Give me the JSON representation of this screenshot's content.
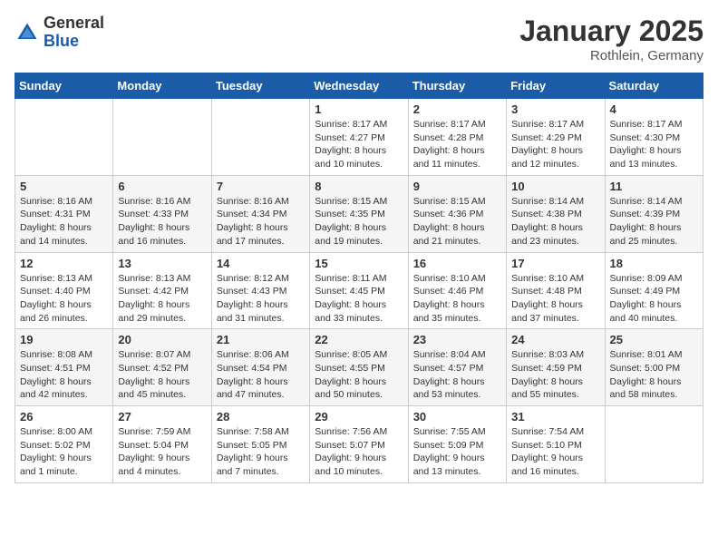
{
  "logo": {
    "general": "General",
    "blue": "Blue"
  },
  "header": {
    "month": "January 2025",
    "location": "Rothlein, Germany"
  },
  "weekdays": [
    "Sunday",
    "Monday",
    "Tuesday",
    "Wednesday",
    "Thursday",
    "Friday",
    "Saturday"
  ],
  "weeks": [
    [
      {
        "day": "",
        "info": ""
      },
      {
        "day": "",
        "info": ""
      },
      {
        "day": "",
        "info": ""
      },
      {
        "day": "1",
        "info": "Sunrise: 8:17 AM\nSunset: 4:27 PM\nDaylight: 8 hours\nand 10 minutes."
      },
      {
        "day": "2",
        "info": "Sunrise: 8:17 AM\nSunset: 4:28 PM\nDaylight: 8 hours\nand 11 minutes."
      },
      {
        "day": "3",
        "info": "Sunrise: 8:17 AM\nSunset: 4:29 PM\nDaylight: 8 hours\nand 12 minutes."
      },
      {
        "day": "4",
        "info": "Sunrise: 8:17 AM\nSunset: 4:30 PM\nDaylight: 8 hours\nand 13 minutes."
      }
    ],
    [
      {
        "day": "5",
        "info": "Sunrise: 8:16 AM\nSunset: 4:31 PM\nDaylight: 8 hours\nand 14 minutes."
      },
      {
        "day": "6",
        "info": "Sunrise: 8:16 AM\nSunset: 4:33 PM\nDaylight: 8 hours\nand 16 minutes."
      },
      {
        "day": "7",
        "info": "Sunrise: 8:16 AM\nSunset: 4:34 PM\nDaylight: 8 hours\nand 17 minutes."
      },
      {
        "day": "8",
        "info": "Sunrise: 8:15 AM\nSunset: 4:35 PM\nDaylight: 8 hours\nand 19 minutes."
      },
      {
        "day": "9",
        "info": "Sunrise: 8:15 AM\nSunset: 4:36 PM\nDaylight: 8 hours\nand 21 minutes."
      },
      {
        "day": "10",
        "info": "Sunrise: 8:14 AM\nSunset: 4:38 PM\nDaylight: 8 hours\nand 23 minutes."
      },
      {
        "day": "11",
        "info": "Sunrise: 8:14 AM\nSunset: 4:39 PM\nDaylight: 8 hours\nand 25 minutes."
      }
    ],
    [
      {
        "day": "12",
        "info": "Sunrise: 8:13 AM\nSunset: 4:40 PM\nDaylight: 8 hours\nand 26 minutes."
      },
      {
        "day": "13",
        "info": "Sunrise: 8:13 AM\nSunset: 4:42 PM\nDaylight: 8 hours\nand 29 minutes."
      },
      {
        "day": "14",
        "info": "Sunrise: 8:12 AM\nSunset: 4:43 PM\nDaylight: 8 hours\nand 31 minutes."
      },
      {
        "day": "15",
        "info": "Sunrise: 8:11 AM\nSunset: 4:45 PM\nDaylight: 8 hours\nand 33 minutes."
      },
      {
        "day": "16",
        "info": "Sunrise: 8:10 AM\nSunset: 4:46 PM\nDaylight: 8 hours\nand 35 minutes."
      },
      {
        "day": "17",
        "info": "Sunrise: 8:10 AM\nSunset: 4:48 PM\nDaylight: 8 hours\nand 37 minutes."
      },
      {
        "day": "18",
        "info": "Sunrise: 8:09 AM\nSunset: 4:49 PM\nDaylight: 8 hours\nand 40 minutes."
      }
    ],
    [
      {
        "day": "19",
        "info": "Sunrise: 8:08 AM\nSunset: 4:51 PM\nDaylight: 8 hours\nand 42 minutes."
      },
      {
        "day": "20",
        "info": "Sunrise: 8:07 AM\nSunset: 4:52 PM\nDaylight: 8 hours\nand 45 minutes."
      },
      {
        "day": "21",
        "info": "Sunrise: 8:06 AM\nSunset: 4:54 PM\nDaylight: 8 hours\nand 47 minutes."
      },
      {
        "day": "22",
        "info": "Sunrise: 8:05 AM\nSunset: 4:55 PM\nDaylight: 8 hours\nand 50 minutes."
      },
      {
        "day": "23",
        "info": "Sunrise: 8:04 AM\nSunset: 4:57 PM\nDaylight: 8 hours\nand 53 minutes."
      },
      {
        "day": "24",
        "info": "Sunrise: 8:03 AM\nSunset: 4:59 PM\nDaylight: 8 hours\nand 55 minutes."
      },
      {
        "day": "25",
        "info": "Sunrise: 8:01 AM\nSunset: 5:00 PM\nDaylight: 8 hours\nand 58 minutes."
      }
    ],
    [
      {
        "day": "26",
        "info": "Sunrise: 8:00 AM\nSunset: 5:02 PM\nDaylight: 9 hours\nand 1 minute."
      },
      {
        "day": "27",
        "info": "Sunrise: 7:59 AM\nSunset: 5:04 PM\nDaylight: 9 hours\nand 4 minutes."
      },
      {
        "day": "28",
        "info": "Sunrise: 7:58 AM\nSunset: 5:05 PM\nDaylight: 9 hours\nand 7 minutes."
      },
      {
        "day": "29",
        "info": "Sunrise: 7:56 AM\nSunset: 5:07 PM\nDaylight: 9 hours\nand 10 minutes."
      },
      {
        "day": "30",
        "info": "Sunrise: 7:55 AM\nSunset: 5:09 PM\nDaylight: 9 hours\nand 13 minutes."
      },
      {
        "day": "31",
        "info": "Sunrise: 7:54 AM\nSunset: 5:10 PM\nDaylight: 9 hours\nand 16 minutes."
      },
      {
        "day": "",
        "info": ""
      }
    ]
  ]
}
